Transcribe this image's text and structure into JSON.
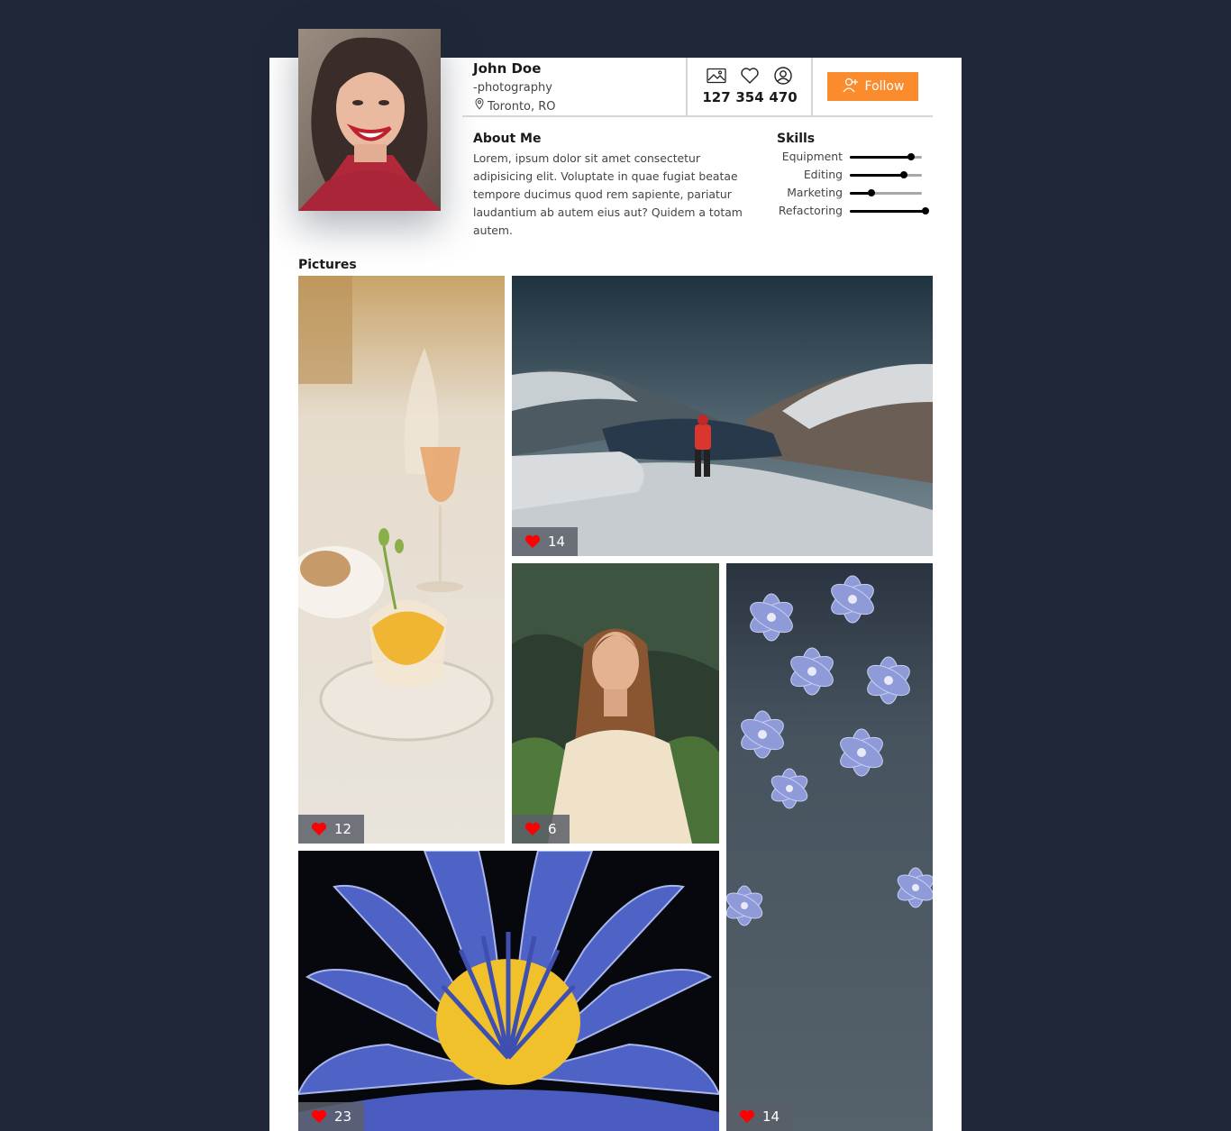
{
  "profile": {
    "name": "John Doe",
    "tagline": "-photography",
    "location": "Toronto, RO",
    "avatar_icon": "portrait-photo"
  },
  "stats": [
    {
      "icon": "image-icon",
      "value": "127"
    },
    {
      "icon": "heart-icon",
      "value": "354"
    },
    {
      "icon": "user-circle-icon",
      "value": "470"
    }
  ],
  "follow": {
    "label": "Follow",
    "icon": "user-plus-icon",
    "color": "#fb8c2d"
  },
  "about": {
    "title": "About Me",
    "text": "Lorem, ipsum dolor sit amet consectetur adipisicing elit. Voluptate in quae fugiat beatae tempore ducimus quod rem sapiente, pariatur laudantium ab autem eius aut? Quidem a totam autem."
  },
  "skills": {
    "title": "Skills",
    "items": [
      {
        "label": "Equipment",
        "level": 0.85
      },
      {
        "label": "Editing",
        "level": 0.75
      },
      {
        "label": "Marketing",
        "level": 0.3
      },
      {
        "label": "Refactoring",
        "level": 1.05
      }
    ]
  },
  "pictures": {
    "title": "Pictures",
    "items": [
      {
        "subject": "dessert-and-wine-glasses",
        "likes": "12"
      },
      {
        "subject": "hiker-on-snowy-mountain",
        "likes": "14"
      },
      {
        "subject": "woman-among-ferns",
        "likes": "6"
      },
      {
        "subject": "blue-anemone-flowers-on-fabric",
        "likes": "14"
      },
      {
        "subject": "blue-water-lily-with-droplets",
        "likes": "23"
      }
    ]
  },
  "colors": {
    "background": "#1f2738",
    "card": "#ffffff",
    "accent": "#fb8c2d",
    "like": "#ff0000"
  }
}
